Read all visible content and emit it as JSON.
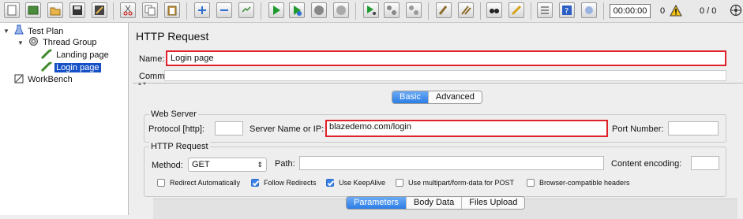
{
  "toolbar": {
    "timer": "00:00:00",
    "error_count": "0",
    "thread_count": "0 / 0",
    "buttons": [
      "new",
      "templates",
      "open",
      "save",
      "save-screenshot",
      "cut",
      "copy",
      "paste",
      "expand",
      "collapse",
      "toggle",
      "start",
      "start-no-pauses",
      "stop",
      "shutdown",
      "remote-start",
      "remote-stop",
      "remote-exit",
      "clear",
      "clear-all",
      "search",
      "reset-search",
      "function-helper",
      "help",
      "remote-start-all"
    ]
  },
  "tree": {
    "test_plan": "Test Plan",
    "thread_group": "Thread Group",
    "landing_page": "Landing page",
    "login_page": "Login page",
    "workbench": "WorkBench"
  },
  "sampler": {
    "title": "HTTP Request",
    "name_label": "Name:",
    "name_value": "Login page",
    "comments_label": "Comments:",
    "tabs": [
      "Basic",
      "Advanced"
    ],
    "web_server": {
      "label": "Web Server",
      "protocol_label": "Protocol [http]:",
      "protocol_value": "",
      "server_label": "Server Name or IP:",
      "server_value": "blazedemo.com/login",
      "port_label": "Port Number:",
      "port_value": ""
    },
    "http_request": {
      "label": "HTTP Request",
      "method_label": "Method:",
      "method_value": "GET",
      "path_label": "Path:",
      "path_value": "",
      "encoding_label": "Content encoding:",
      "encoding_value": ""
    },
    "options": [
      {
        "label": "Redirect Automatically",
        "checked": false
      },
      {
        "label": "Follow Redirects",
        "checked": true
      },
      {
        "label": "Use KeepAlive",
        "checked": true
      },
      {
        "label": "Use multipart/form-data for POST",
        "checked": false
      },
      {
        "label": "Browser-compatible headers",
        "checked": false
      }
    ],
    "bottom_tabs": [
      "Parameters",
      "Body Data",
      "Files Upload"
    ]
  },
  "colors": {
    "accent": "#2c7de6",
    "highlight": "#e12129",
    "selection": "#1650c6"
  }
}
